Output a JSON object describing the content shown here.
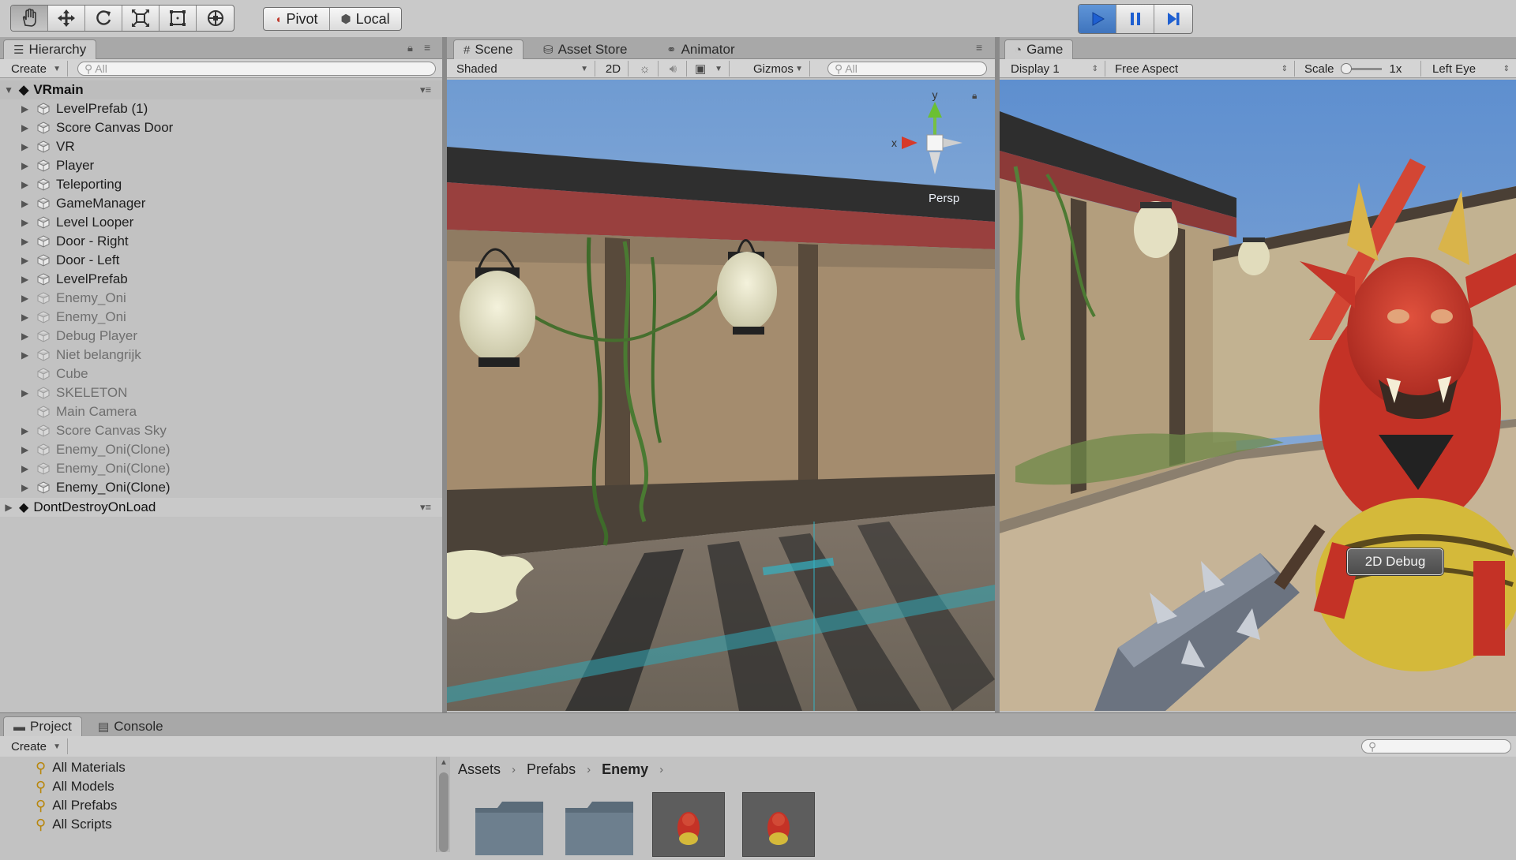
{
  "toolbar": {
    "tools": [
      "hand-tool",
      "move-tool",
      "rotate-tool",
      "scale-tool",
      "rect-tool",
      "transform-tool"
    ],
    "pivot_label": "Pivot",
    "local_label": "Local",
    "play_controls": [
      "play",
      "pause",
      "step"
    ]
  },
  "hierarchy": {
    "tab_label": "Hierarchy",
    "create_label": "Create",
    "search_placeholder": "All",
    "scene_name": "VRmain",
    "items": [
      {
        "label": "LevelPrefab (1)",
        "expandable": true,
        "dim": false
      },
      {
        "label": "Score Canvas Door",
        "expandable": true,
        "dim": false
      },
      {
        "label": "VR",
        "expandable": true,
        "dim": false
      },
      {
        "label": "Player",
        "expandable": true,
        "dim": false
      },
      {
        "label": "Teleporting",
        "expandable": true,
        "dim": false
      },
      {
        "label": "GameManager",
        "expandable": true,
        "dim": false
      },
      {
        "label": "Level Looper",
        "expandable": true,
        "dim": false
      },
      {
        "label": "Door - Right",
        "expandable": true,
        "dim": false
      },
      {
        "label": "Door - Left",
        "expandable": true,
        "dim": false
      },
      {
        "label": "LevelPrefab",
        "expandable": true,
        "dim": false
      },
      {
        "label": "Enemy_Oni",
        "expandable": true,
        "dim": true
      },
      {
        "label": "Enemy_Oni",
        "expandable": true,
        "dim": true
      },
      {
        "label": "Debug Player",
        "expandable": true,
        "dim": true
      },
      {
        "label": "Niet belangrijk",
        "expandable": true,
        "dim": true
      },
      {
        "label": "Cube",
        "expandable": false,
        "dim": true
      },
      {
        "label": "SKELETON",
        "expandable": true,
        "dim": true
      },
      {
        "label": "Main Camera",
        "expandable": false,
        "dim": true
      },
      {
        "label": "Score Canvas Sky",
        "expandable": true,
        "dim": true
      },
      {
        "label": "Enemy_Oni(Clone)",
        "expandable": true,
        "dim": true
      },
      {
        "label": "Enemy_Oni(Clone)",
        "expandable": true,
        "dim": true
      },
      {
        "label": "Enemy_Oni(Clone)",
        "expandable": true,
        "dim": false
      }
    ],
    "dont_destroy_label": "DontDestroyOnLoad"
  },
  "scene": {
    "tab_scene": "Scene",
    "tab_asset_store": "Asset Store",
    "tab_animator": "Animator",
    "shading_mode": "Shaded",
    "mode_2d": "2D",
    "gizmos_label": "Gizmos",
    "search_placeholder": "All",
    "gizmo_y": "y",
    "gizmo_x": "x",
    "persp_label": "Persp"
  },
  "game": {
    "tab_label": "Game",
    "display_label": "Display 1",
    "aspect_label": "Free Aspect",
    "scale_label": "Scale",
    "scale_value": "1x",
    "eye_label": "Left Eye",
    "debug_button": "2D Debug"
  },
  "project": {
    "tab_project": "Project",
    "tab_console": "Console",
    "create_label": "Create",
    "favorites": [
      "All Materials",
      "All Models",
      "All Prefabs",
      "All Scripts"
    ],
    "breadcrumb": [
      "Assets",
      "Prefabs",
      "Enemy"
    ]
  },
  "colors": {
    "accent_play": "#3f74bd",
    "sky": "#7da6d4",
    "wall_red": "#9b3b3a",
    "oni_red": "#d03a2c"
  }
}
